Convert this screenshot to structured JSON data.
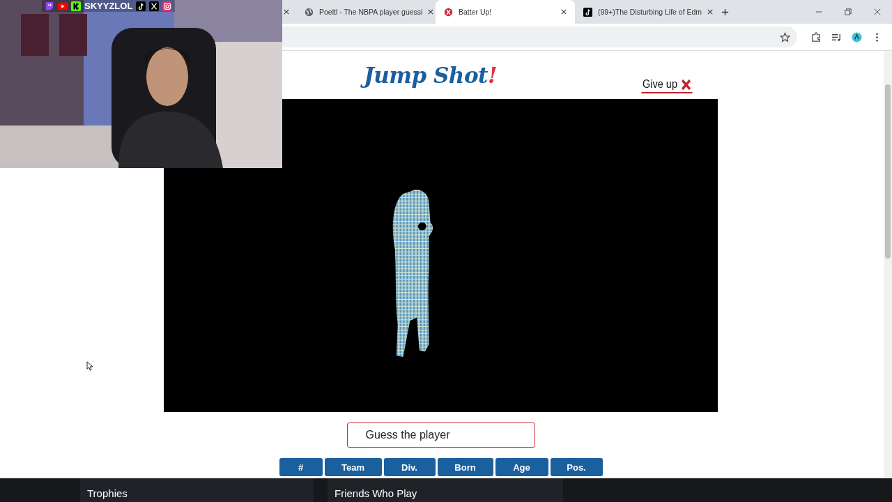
{
  "stream_overlay": {
    "handle": "SKYYZLOL"
  },
  "browser": {
    "tabs": [
      {
        "title": "Poeltl - The NBPA player guessi",
        "selected": false
      },
      {
        "title": "Batter Up!",
        "selected": true
      },
      {
        "title": "(99+)The Disturbing Life of Edm",
        "selected": false
      }
    ]
  },
  "page": {
    "logo": {
      "main": "Jump Shot",
      "accent": "!"
    },
    "give_up": "Give up",
    "guess": {
      "placeholder": "Guess the player"
    },
    "columns": [
      "#",
      "Team",
      "Div.",
      "Born",
      "Age",
      "Pos."
    ]
  },
  "background_page": {
    "sections": [
      "Trophies",
      "Friends Who Play"
    ]
  }
}
